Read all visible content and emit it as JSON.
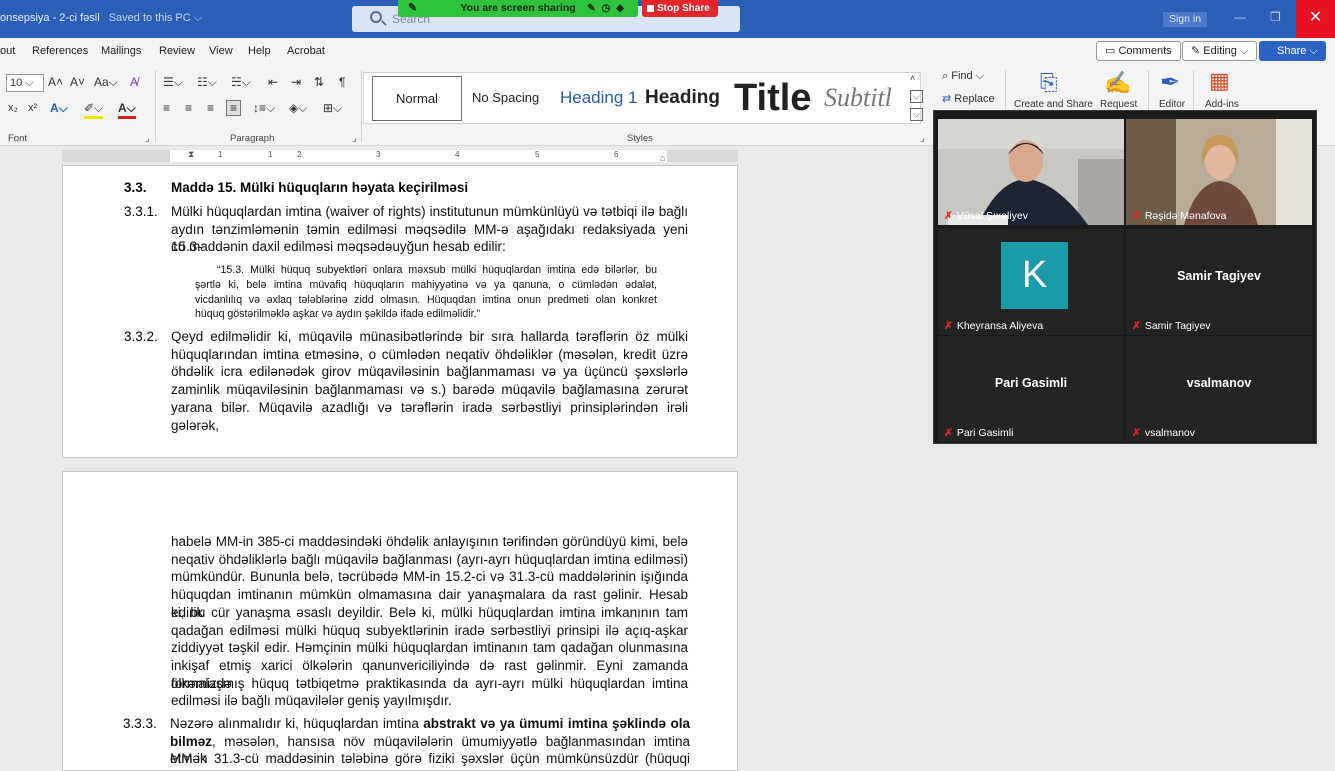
{
  "titlebar": {
    "doc_name": "onsepsiya - 2-ci fəsil",
    "saved_status": "Saved to this PC",
    "search_placeholder": "Search",
    "screen_share_status": "You are screen sharing",
    "stop_share": "Stop Share",
    "sign_in": "Sign in"
  },
  "menu": {
    "items": [
      "out",
      "References",
      "Mailings",
      "Review",
      "View",
      "Help",
      "Acrobat"
    ],
    "comments": "Comments",
    "editing": "Editing",
    "share": "Share"
  },
  "ribbon": {
    "font_size": "10",
    "group_font": "Font",
    "group_paragraph": "Paragraph",
    "group_styles": "Styles",
    "styles": [
      "Normal",
      "No Spacing",
      "Heading 1",
      "Heading",
      "Title",
      "Subtitl"
    ],
    "find": "Find",
    "replace": "Replace",
    "create_share": "Create and Share",
    "request": "Request",
    "editor": "Editor",
    "addins": "Add-ins"
  },
  "ruler": {
    "numbers": [
      "1",
      "1",
      "2",
      "3",
      "4",
      "5",
      "6"
    ]
  },
  "document": {
    "page1": {
      "section_num": "3.3.",
      "section_title": "Maddə 15. Mülki hüquqların həyata keçirilməsi",
      "para1_num": "3.3.1.",
      "para1_lines": [
        "Mülki hüquqlardan imtina (waiver of rights) institutunun mümkünlüyü və tətbiqi ilə bağlı",
        "aydın tənzimləmənin təmin edilməsi məqsədilə MM-ə aşağıdakı redaksiyada yeni 15.3-",
        "cü maddənin daxil edilməsi məqsədəuyğun hesab edilir:"
      ],
      "quote_lines": [
        "“15.3. Mülki hüquq subyektləri onlara məxsub mülki hüquqlardan imtina edə bilərlər, bu",
        "şərtlə ki, belə imtina müvafiq hüquqların mahiyyətinə və ya qanuna, o cümlədən ədalət,",
        "vicdanlılıq və əxlaq tələblərinə zidd olmasın. Hüquqdan imtina onun predmeti olan konkret",
        "hüquq göstərilməklə aşkar və aydın şəkildə ifadə edilməlidir.”"
      ],
      "para2_num": "3.3.2.",
      "para2_lines": [
        "Qeyd edilməlidir ki, müqavilə münasibətlərində bir sıra hallarda tərəflərin öz mülki",
        "hüquqlarından imtina etməsinə, o cümlədən neqativ öhdəliklər (məsələn, kredit üzrə",
        "öhdəlik icra edilənədək girov müqaviləsinin bağlanmaması və ya üçüncü şəxslərlə",
        "zaminlik müqaviləsinin bağlanmaması və s.) barədə müqavilə bağlamasına zərurət",
        "yarana bilər. Müqavilə azadlığı və tərəflərin iradə sərbəstliyi prinsiplərindən irəli gələrək,"
      ]
    },
    "page2": {
      "para_lines": [
        "habelə MM-in 385-ci maddəsindəki öhdəlik anlayışının tərifindən göründüyü kimi, belə",
        "neqativ öhdəliklərlə bağlı müqavilə bağlanması (ayrı-ayrı hüquqlardan imtina edilməsi)",
        "mümkündür. Bununla belə, təcrübədə MM-in 15.2-ci və 31.3-cü maddələrinin işığında",
        "hüquqdan imtinanın mümkün olmamasına dair yanaşmalara da rast gəlinir. Hesab edirik",
        "ki, bu cür yanaşma əsaslı deyildir. Belə ki, mülki hüquqlardan imtina imkanının tam",
        "qadağan edilməsi mülki hüquq subyektlərinin iradə sərbəstliyi prinsipi ilə açıq-aşkar",
        "ziddiyyət təşkil edir. Həmçinin mülki hüquqlardan imtinanın tam qadağan olunmasına",
        "inkişaf etmiş xarici ölkələrin qanunvericiliyində də rast gəlinmir. Eyni zamanda ölkəmizdə",
        "formalaşmış hüquq tətbiqetmə praktikasında da ayrı-ayrı mülki hüquqlardan imtina",
        "edilməsi ilə bağlı müqavilələr geniş yayılmışdır."
      ],
      "para3_num": "3.3.3.",
      "para3_line1_a": "Nəzərə alınmalıdır ki, hüquqlardan imtina",
      "para3_line1_b": "abstrakt və ya ümumi imtina şəklində ola",
      "para3_line2_a": "bilməz",
      "para3_line2_b": ", məsələn, hansısa növ müqavilələrin ümumiyyətlə bağlanmasından imtina etmək",
      "para3_line3": "MM-in 31.3-cü maddəsinin tələbinə görə fiziki şəxslər üçün mümkünsüzdür (hüquqi"
    }
  },
  "zoom": {
    "participants": [
      {
        "name": "Vüsal Şıxəliyev"
      },
      {
        "name": "Rəşidə Mənafova"
      },
      {
        "name": "Kheyransa Aliyeva",
        "initial": "K"
      },
      {
        "name": "Samir Tagiyev",
        "center": "Samir Tagiyev"
      },
      {
        "name": "Pari Gasimli",
        "center": "Pari Gasimli"
      },
      {
        "name": "vsalmanov",
        "center": "vsalmanov"
      }
    ]
  },
  "icons": {
    "mic_muted": "🎙"
  }
}
